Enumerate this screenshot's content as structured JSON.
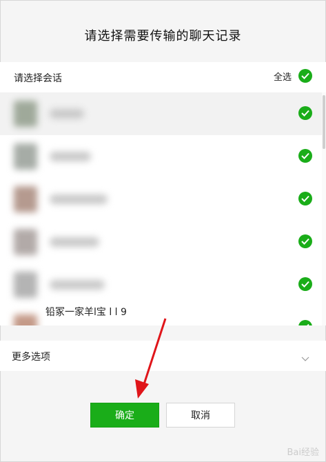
{
  "dialog": {
    "title": "请选择需要传输的聊天记录",
    "select_label": "请选择会话",
    "select_all_label": "全选",
    "more_options_label": "更多选项",
    "confirm_label": "确定",
    "cancel_label": "取消"
  },
  "conversations": [
    {
      "checked": true,
      "avatar_color": "#9fa99a"
    },
    {
      "checked": true,
      "avatar_color": "#a6aca6"
    },
    {
      "checked": true,
      "avatar_color": "#b59a8f"
    },
    {
      "checked": true,
      "avatar_color": "#b2aaa8"
    },
    {
      "checked": true,
      "avatar_color": "#b4b4b4"
    },
    {
      "checked": true,
      "avatar_color": "#c49a88",
      "partial_text": "铅冢一家羊l宝 l l 9"
    }
  ],
  "colors": {
    "accent": "#1aad19",
    "annotation_arrow": "#e0151a"
  },
  "watermark": "Bai经验"
}
